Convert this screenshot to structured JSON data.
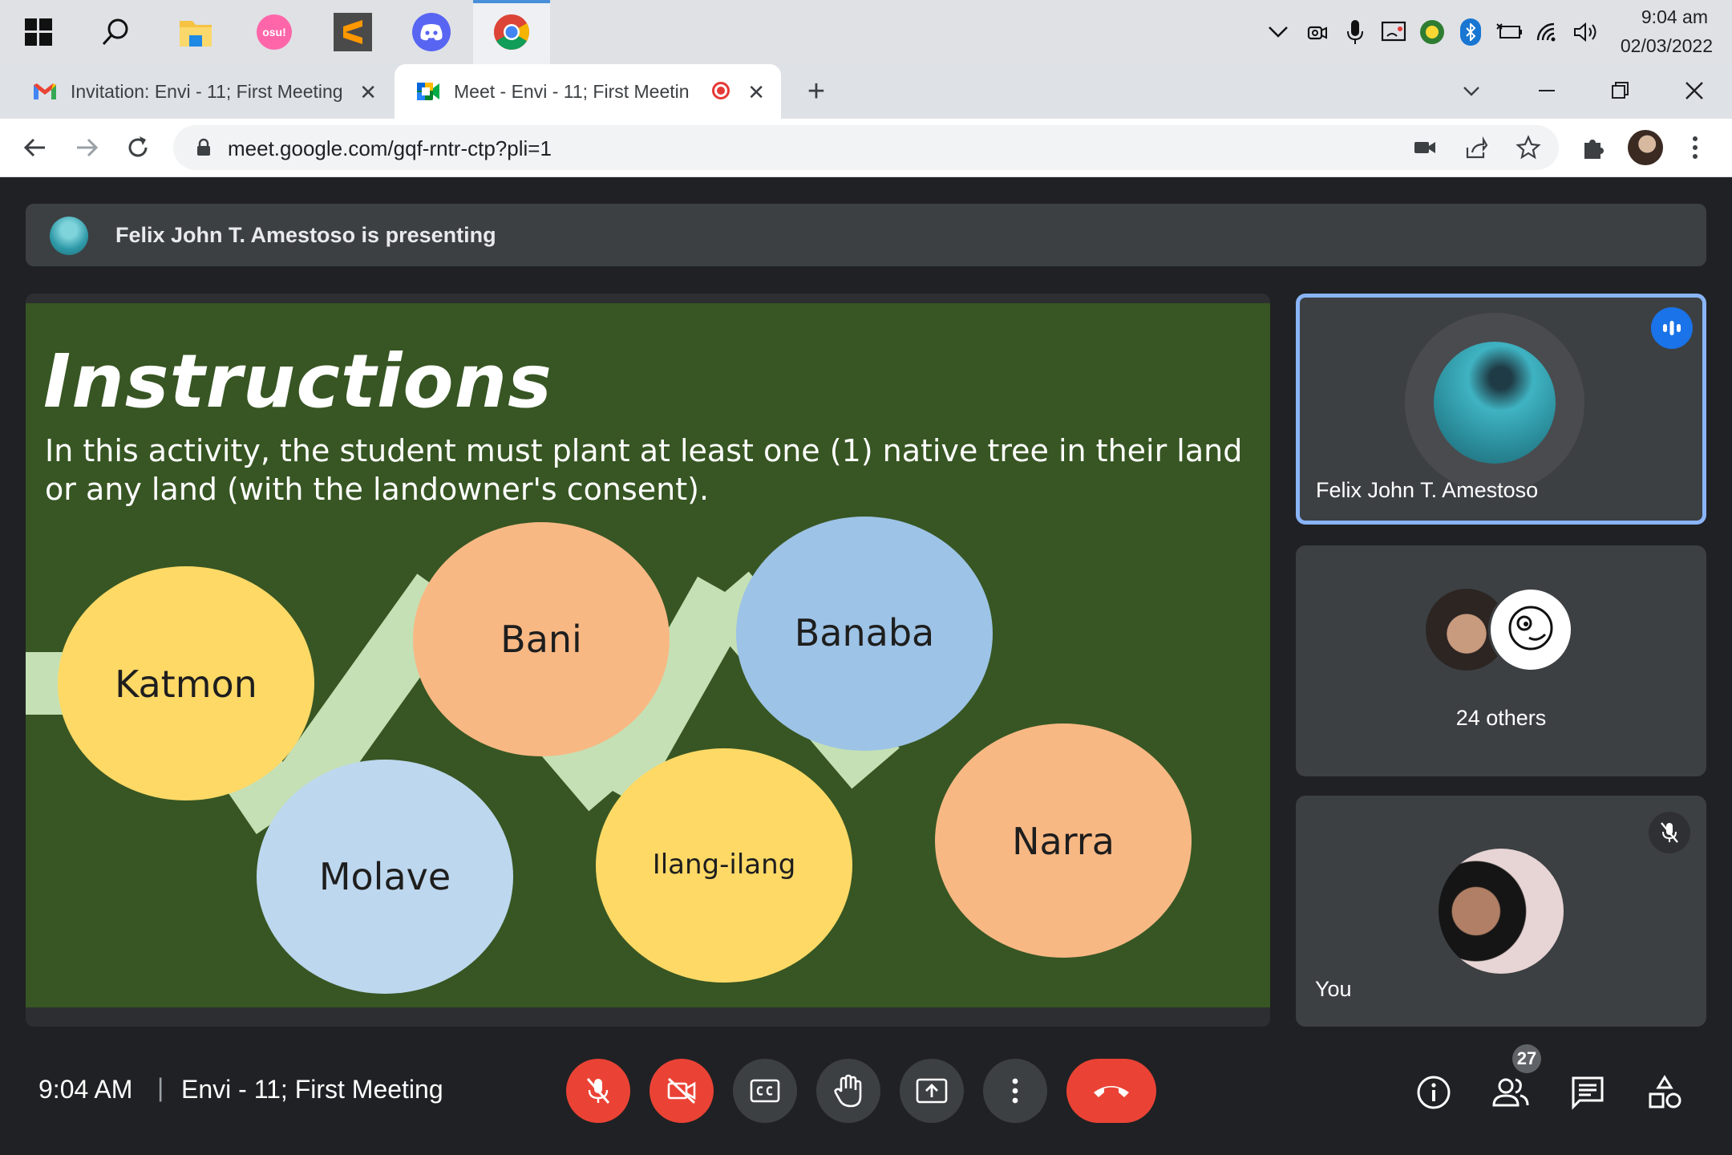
{
  "taskbar": {
    "apps": [
      {
        "name": "start-icon"
      },
      {
        "name": "search-icon"
      },
      {
        "name": "file-explorer-icon"
      },
      {
        "name": "osu-icon",
        "label": "osu!"
      },
      {
        "name": "sublime-text-icon"
      },
      {
        "name": "discord-icon"
      },
      {
        "name": "chrome-icon"
      }
    ],
    "tray": [
      "chevron-up-icon",
      "camera-icon",
      "microphone-icon",
      "cast-icon",
      "green-app-icon",
      "bluetooth-icon",
      "battery-icon",
      "wifi-icon",
      "volume-icon"
    ],
    "time": "9:04 am",
    "date": "02/03/2022"
  },
  "browser": {
    "tabs": [
      {
        "title": "Invitation: Envi - 11; First Meeting",
        "icon": "gmail-icon"
      },
      {
        "title": "Meet - Envi - 11; First Meetin",
        "icon": "google-meet-icon",
        "recording": true
      }
    ],
    "new_tab": "+",
    "url": "meet.google.com/gqf-rntr-ctp?pli=1"
  },
  "meet": {
    "presenting_banner": "Felix John T. Amestoso is presenting",
    "slide": {
      "title": "Instructions",
      "body": "In this activity, the student must plant at least one (1) native tree in their land or any land (with the landowner's consent).",
      "trees": [
        "Katmon",
        "Molave",
        "Bani",
        "Ilang-ilang",
        "Banaba",
        "Narra"
      ],
      "colors": {
        "background": "#375623",
        "yellow": "#ffd966",
        "orange": "#f8b884",
        "blue": "#9dc3e6",
        "light_blue": "#bdd7ee",
        "connector": "#c5e0b4"
      }
    },
    "participants": {
      "presenter": "Felix John T. Amestoso",
      "others": "24 others",
      "self": "You"
    },
    "bottom_bar": {
      "time": "9:04 AM",
      "separator": "|",
      "meeting_name": "Envi - 11; First Meeting",
      "people_count": "27"
    },
    "colors": {
      "accent": "#8ab4f8",
      "danger": "#ea4335",
      "surface": "#3c4043"
    }
  }
}
